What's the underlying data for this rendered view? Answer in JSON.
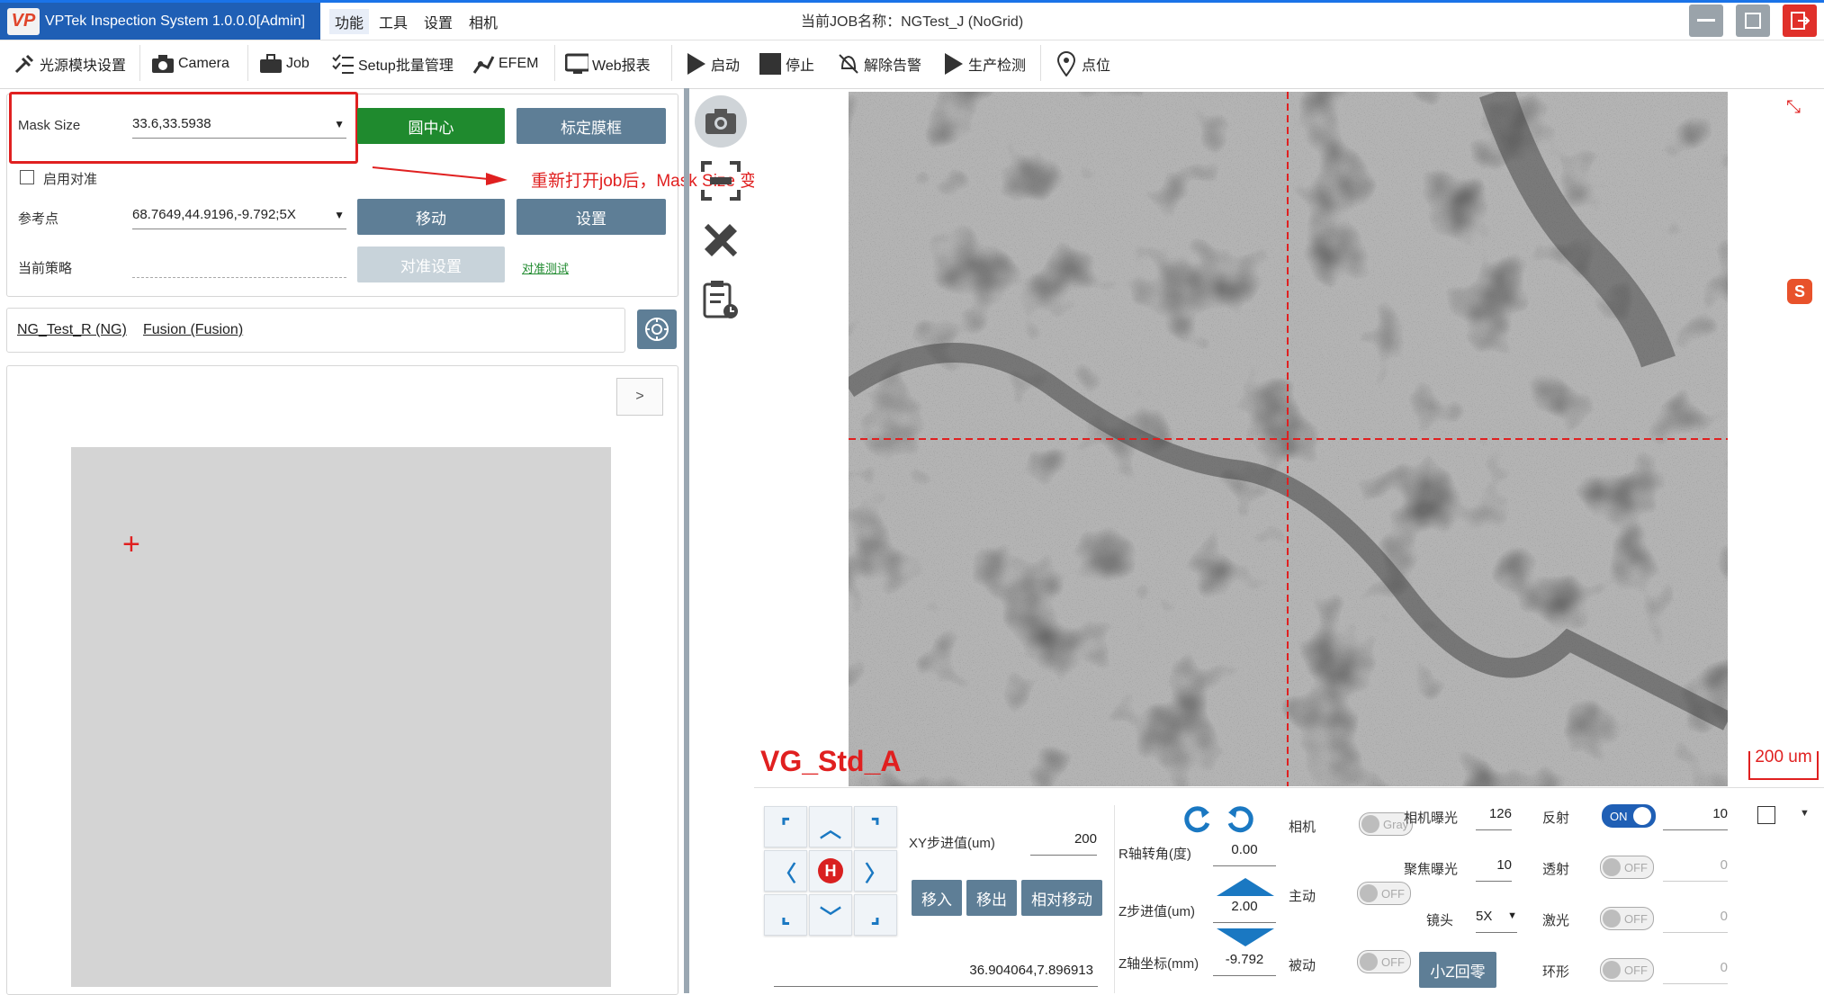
{
  "window": {
    "app_title": "VPTek Inspection System 1.0.0.0[Admin]",
    "logo_text": "VP",
    "job_label": "当前JOB名称：NGTest_J (NoGrid)",
    "menu": [
      "功能",
      "工具",
      "设置",
      "相机"
    ]
  },
  "toolbar": {
    "items": [
      "光源模块设置",
      "Camera",
      "Job",
      "Setup批量管理",
      "EFEM",
      "Web报表",
      "启动",
      "停止",
      "解除告警",
      "生产检测",
      "点位"
    ]
  },
  "left": {
    "mask_size_label": "Mask Size",
    "mask_size_value": "33.6,33.5938",
    "btn_circle_center": "圆中心",
    "btn_calibrate_frame": "标定膜框",
    "annotation": "重新打开job后，Mask Size 变回了预设值",
    "enable_align_label": "启用对准",
    "ref_point_label": "参考点",
    "ref_point_value": "68.7649,44.9196,-9.792;5X",
    "btn_move": "移动",
    "btn_set": "设置",
    "strategy_label": "当前策略",
    "btn_align_settings": "对准设置",
    "align_test_link": "对准测试",
    "recipe_links": [
      "NG_Test_R (NG)",
      "Fusion (Fusion)"
    ],
    "expand_btn": ">",
    "preview_marker": "+"
  },
  "viewer": {
    "overlay_label": "VG_Std_A",
    "scale_bar_label": "200 um",
    "accent_red": "#e02020"
  },
  "controls": {
    "xy_step_label": "XY步进值(um)",
    "xy_step_value": "200",
    "btn_move_in": "移入",
    "btn_move_out": "移出",
    "btn_relative_move": "相对移动",
    "home_label": "H",
    "coords_value": "36.904064,7.896913",
    "r_axis_label": "R轴转角(度)",
    "r_axis_value": "0.00",
    "z_step_label": "Z步进值(um)",
    "z_step_value": "2.00",
    "z_coord_label": "Z轴坐标(mm)",
    "z_coord_value": "-9.792",
    "camera_label": "相机",
    "gray_label": "Gray",
    "main_label": "主动",
    "passive_label": "被动",
    "off_label": "OFF",
    "on_label": "ON",
    "btn_small_z_home": "小Z回零",
    "exposure_label": "相机曝光",
    "exposure_value": "126",
    "focus_exposure_label": "聚焦曝光",
    "focus_exposure_value": "10",
    "lens_label": "镜头",
    "lens_value": "5X",
    "reflect_label": "反射",
    "reflect_value": "10",
    "transmit_label": "透射",
    "transmit_value": "0",
    "laser_label": "激光",
    "laser_value": "0",
    "ring_label": "环形",
    "ring_value": "0"
  }
}
